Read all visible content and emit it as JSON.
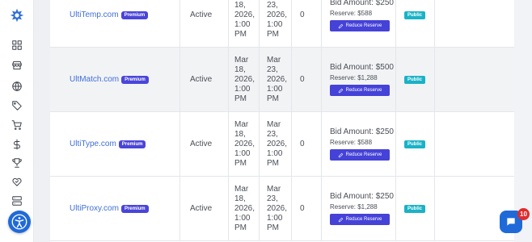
{
  "sidebar": {
    "icons": [
      "logo-icon",
      "dashboard-icon",
      "store-icon",
      "globe-icon",
      "tag-icon",
      "cart-icon",
      "dollar-icon",
      "trophy-icon",
      "handshake-icon",
      "server-icon"
    ],
    "accessibility_icon": "accessibility-icon"
  },
  "rows": [
    {
      "domain": "UltiTemp.com",
      "badge": "Premium",
      "status": "Active",
      "start": [
        "18,",
        "2026,",
        "1:00",
        "PM"
      ],
      "end": [
        "23,",
        "2026,",
        "1:00",
        "PM"
      ],
      "bids": "0",
      "bid_amount": "Bid Amount: $250",
      "reserve": "Reserve: $588",
      "button": "Reduce Reserve",
      "visibility": "Public"
    },
    {
      "domain": "UltMatch.com",
      "badge": "Premium",
      "status": "Active",
      "start": [
        "Mar",
        "18,",
        "2026,",
        "1:00",
        "PM"
      ],
      "end": [
        "Mar",
        "23,",
        "2026,",
        "1:00",
        "PM"
      ],
      "bids": "0",
      "bid_amount": "Bid Amount: $500",
      "reserve": "Reserve: $1,288",
      "button": "Reduce Reserve",
      "visibility": "Public"
    },
    {
      "domain": "UltiType.com",
      "badge": "Premium",
      "status": "Active",
      "start": [
        "Mar",
        "18,",
        "2026,",
        "1:00",
        "PM"
      ],
      "end": [
        "Mar",
        "23,",
        "2026,",
        "1:00",
        "PM"
      ],
      "bids": "0",
      "bid_amount": "Bid Amount: $250",
      "reserve": "Reserve: $588",
      "button": "Reduce Reserve",
      "visibility": "Public"
    },
    {
      "domain": "UltiProxy.com",
      "badge": "Premium",
      "status": "Active",
      "start": [
        "Mar",
        "18,",
        "2026,",
        "1:00",
        "PM"
      ],
      "end": [
        "Mar",
        "23,",
        "2026,",
        "1:00",
        "PM"
      ],
      "bids": "0",
      "bid_amount": "Bid Amount: $250",
      "reserve": "Reserve: $1,288",
      "button": "Reduce Reserve",
      "visibility": "Public"
    }
  ],
  "chat": {
    "badge_count": "10"
  },
  "colors": {
    "accent": "#4542d8",
    "link": "#3f6fd8",
    "public_badge": "#1ab2c6",
    "chat": "#1f6ad8",
    "notify": "#e02b2b"
  }
}
